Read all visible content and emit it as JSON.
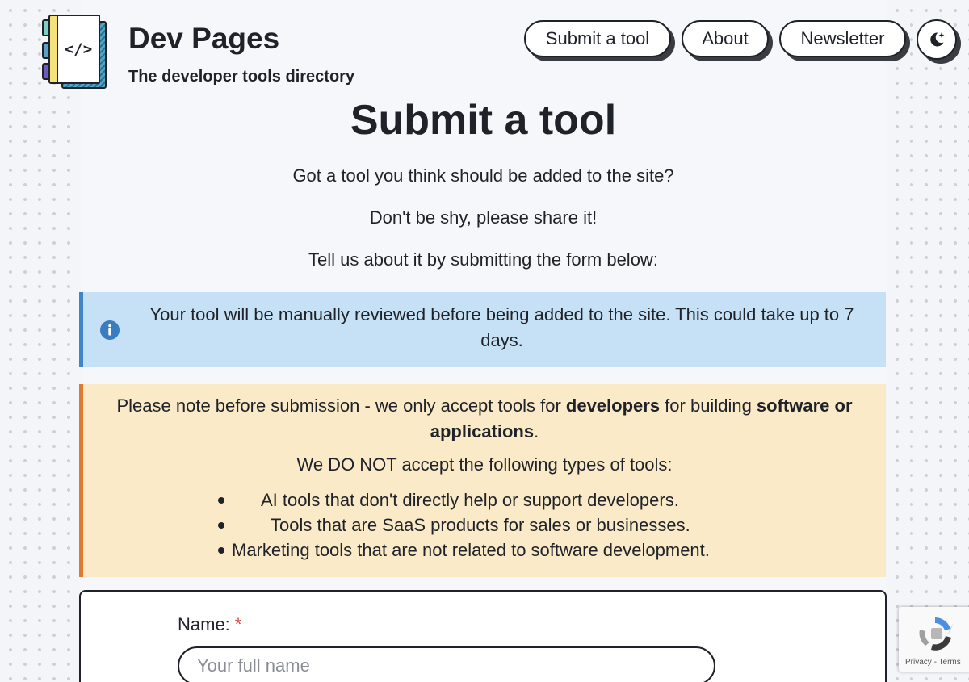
{
  "header": {
    "site_title": "Dev Pages",
    "site_subtitle": "The developer tools directory",
    "logo_glyph": "</>"
  },
  "nav": {
    "items": [
      {
        "label": "Submit a tool"
      },
      {
        "label": "About"
      },
      {
        "label": "Newsletter"
      }
    ],
    "theme_toggle_icon": "moon-stars-icon"
  },
  "page": {
    "heading": "Submit a tool",
    "intro": [
      "Got a tool you think should be added to the site?",
      "Don't be shy, please share it!",
      "Tell us about it by submitting the form below:"
    ]
  },
  "info_callout": {
    "icon": "info-icon",
    "text": "Your tool will be manually reviewed before being added to the site. This could take up to 7 days.",
    "color": "#3f86c8"
  },
  "warning_callout": {
    "note_prefix": "Please note before submission - we only accept tools for ",
    "note_strong_1": "developers",
    "note_middle": " for building ",
    "note_strong_2": "software or applications",
    "note_suffix": ".",
    "lead": "We DO NOT accept the following types of tools:",
    "items": [
      "AI tools that don't directly help or support developers.",
      "Tools that are SaaS products for sales or businesses.",
      "Marketing tools that are not related to software development."
    ],
    "color": "#e07a30"
  },
  "form": {
    "name_label": "Name:",
    "required_mark": "*",
    "name_placeholder": "Your full name",
    "name_value": ""
  },
  "recaptcha": {
    "privacy": "Privacy",
    "separator": "-",
    "terms": "Terms"
  }
}
